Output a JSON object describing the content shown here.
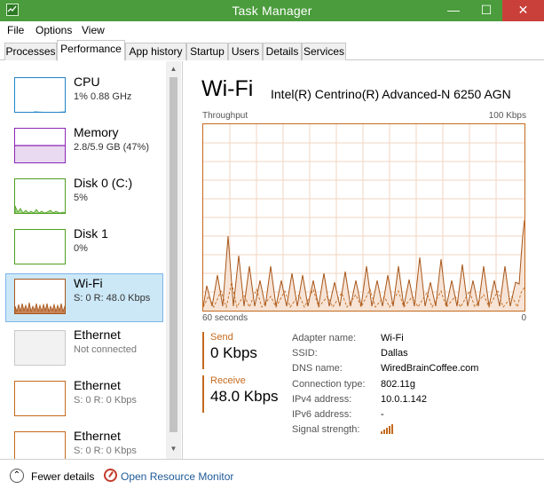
{
  "window": {
    "title": "Task Manager",
    "minimize": "—",
    "maximize": "☐",
    "close": "✕"
  },
  "menu": [
    "File",
    "Options",
    "View"
  ],
  "tabs": [
    "Processes",
    "Performance",
    "App history",
    "Startup",
    "Users",
    "Details",
    "Services"
  ],
  "active_tab": "Performance",
  "resources": [
    {
      "name": "CPU",
      "sub": "1% 0.88 GHz",
      "color": "#1e84c6"
    },
    {
      "name": "Memory",
      "sub": "2.8/5.9 GB (47%)",
      "color": "#8b26b4"
    },
    {
      "name": "Disk 0 (C:)",
      "sub": "5%",
      "color": "#4da021"
    },
    {
      "name": "Disk 1",
      "sub": "0%",
      "color": "#4da021"
    },
    {
      "name": "Wi-Fi",
      "sub": "S: 0 R: 48.0 Kbps",
      "color": "#a7561a"
    },
    {
      "name": "Ethernet",
      "sub": "Not connected",
      "color": "#c0c0c0"
    },
    {
      "name": "Ethernet",
      "sub": "S: 0 R: 0 Kbps",
      "color": "#c46a1e"
    },
    {
      "name": "Ethernet",
      "sub": "S: 0 R: 0 Kbps",
      "color": "#c46a1e"
    }
  ],
  "detail": {
    "title": "Wi-Fi",
    "adapter_model": "Intel(R) Centrino(R) Advanced-N 6250 AGN",
    "throughput_label": "Throughput",
    "max_label": "100 Kbps",
    "time_left": "60 seconds",
    "time_right": "0",
    "send_label": "Send",
    "send_value": "0 Kbps",
    "receive_label": "Receive",
    "receive_value": "48.0 Kbps",
    "props": [
      {
        "key": "Adapter name:",
        "value": "Wi-Fi"
      },
      {
        "key": "SSID:",
        "value": "Dallas"
      },
      {
        "key": "DNS name:",
        "value": "WiredBrainCoffee.com"
      },
      {
        "key": "Connection type:",
        "value": "802.11g"
      },
      {
        "key": "IPv4 address:",
        "value": "10.0.1.142"
      },
      {
        "key": "IPv6 address:",
        "value": "-"
      },
      {
        "key": "Signal strength:",
        "value": ""
      }
    ],
    "signal_bars": 5,
    "accent": "#c46a1e"
  },
  "bottom": {
    "fewer_details": "Fewer details",
    "resource_monitor": "Open Resource Monitor"
  }
}
